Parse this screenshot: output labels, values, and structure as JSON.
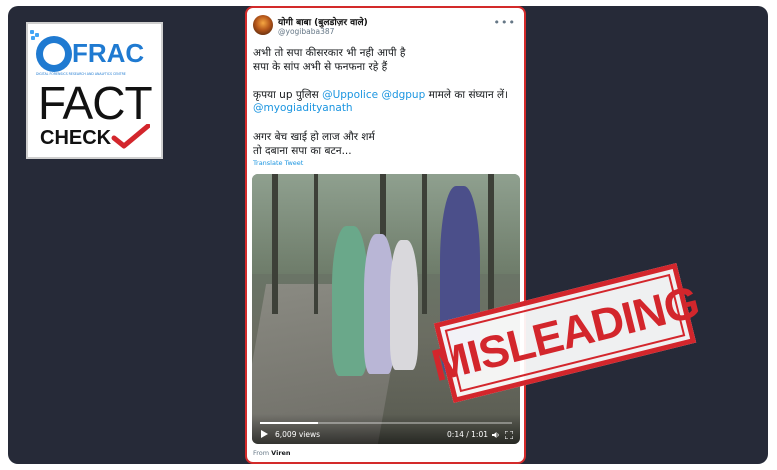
{
  "logo": {
    "frac": "FRAC",
    "tagline": "DIGITAL FORENSICS RESEARCH AND ANALYTICS CENTRE",
    "fact": "FACT",
    "check": "CHECK"
  },
  "tweet": {
    "author_name": "योगी बाबा (बुलडोज़र वाले)",
    "author_handle": "@yogibaba387",
    "lines": [
      "अभी तो सपा कीसरकार भी नही आपी है",
      "सपा के सांप अभी से फनफना रहे हैं"
    ],
    "request_prefix": "कृपया up पुलिस ",
    "mention_1": "@Uppolice",
    "mention_2": "@dgpup",
    "request_suffix": " मामले का संघ्यान लें।",
    "mention_3": "@myogiadityanath",
    "closing_lines": [
      "अगर बेच खाई हो लाज और शर्म",
      "तो दबाना सपा का बटन..."
    ],
    "translate": "Translate Tweet",
    "video": {
      "views": "6,009 views",
      "time": "0:14 / 1:01",
      "progress_fraction": 0.23
    },
    "from_prefix": "From ",
    "from_name": "Viren"
  },
  "stamp": {
    "text": "MISLEADING",
    "color": "#d3262c"
  },
  "colors": {
    "background": "#262a38",
    "card_border": "#d32a2a",
    "mention": "#1b95e0",
    "brand": "#1f7ad1"
  }
}
